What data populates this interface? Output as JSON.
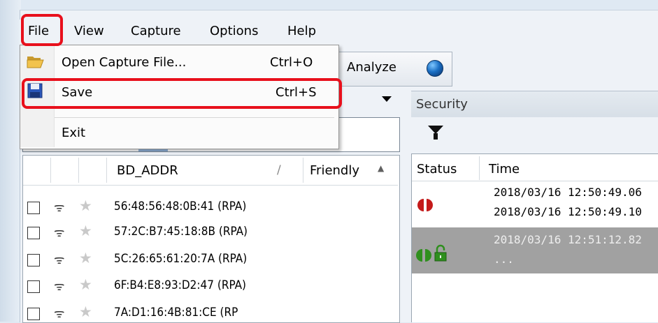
{
  "menubar": {
    "items": [
      "File",
      "View",
      "Capture",
      "Options",
      "Help"
    ]
  },
  "file_menu": {
    "items": [
      {
        "label": "Open Capture File...",
        "shortcut": "Ctrl+O",
        "icon": "folder-open-icon"
      },
      {
        "label": "Save",
        "shortcut": "Ctrl+S",
        "icon": "floppy-disk-icon"
      },
      {
        "label": "Exit",
        "shortcut": ""
      }
    ]
  },
  "toolbar": {
    "analyze_label": "Analyze"
  },
  "devices": {
    "columns": {
      "bd_addr": "BD_ADDR",
      "sort_glyph": "/",
      "friendly": "Friendly"
    },
    "rows": [
      "56:48:56:48:0B:41 (RPA)",
      "57:2C:B7:45:18:8B (RPA)",
      "5C:26:65:61:20:7A (RPA)",
      "6F:B4:E8:93:D2:47 (RPA)",
      "7A:D1:16:4B:81:CE (RP"
    ]
  },
  "security": {
    "title": "Security",
    "columns": {
      "status": "Status",
      "time": "Time"
    },
    "rows": [
      {
        "times": [
          "2018/03/16 12:50:49.06",
          "2018/03/16 12:50:49.10"
        ],
        "status_icon": "red-split-circle-icon"
      },
      {
        "times": [
          "2018/03/16 12:51:12.82",
          "..."
        ],
        "status_icon": "green-split-circle-icon",
        "lock_icon": "unlocked-padlock-icon"
      }
    ]
  },
  "colors": {
    "highlight": "#e8101c",
    "selected_row": "#a1a1a1",
    "status_red": "#c41a1a",
    "status_green": "#2f8f1e"
  }
}
